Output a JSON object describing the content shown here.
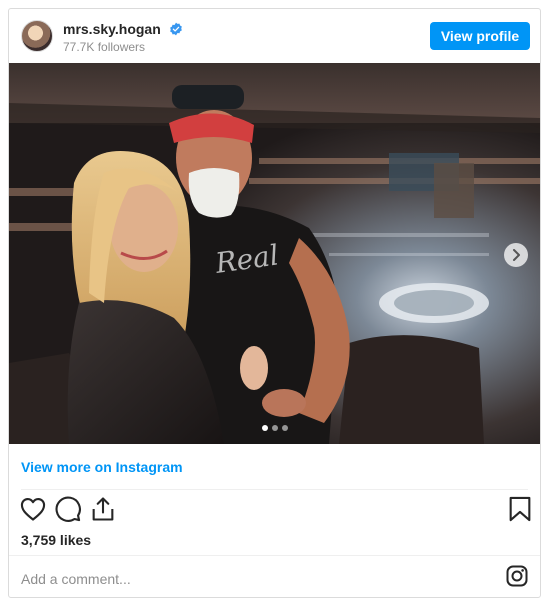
{
  "post": {
    "username": "mrs.sky.hogan",
    "followers": "77.7K followers",
    "view_profile_label": "View profile",
    "view_more_label": "View more on Instagram",
    "likes": "3,759 likes",
    "comment_placeholder": "Add a comment...",
    "carousel": {
      "slide_count": 3,
      "active_index": 0
    }
  },
  "colors": {
    "accent": "#0095f6",
    "verified": "#3897f0",
    "muted": "#8e8e8e",
    "border": "#dbdbdb"
  },
  "icons": [
    "avatar",
    "verified-badge-icon",
    "chevron-right-icon",
    "heart-icon",
    "comment-icon",
    "share-icon",
    "bookmark-icon",
    "instagram-icon"
  ]
}
